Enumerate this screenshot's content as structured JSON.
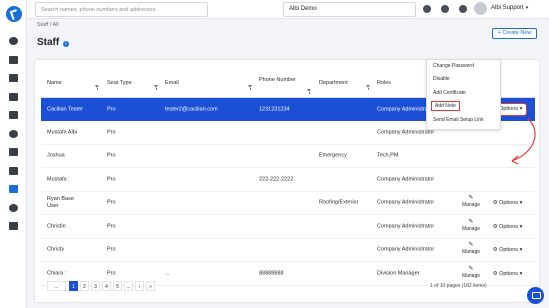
{
  "header": {
    "search_placeholder": "Search names, phone numbers and addresses",
    "company": "Albi Demo",
    "user": "Albi Support"
  },
  "breadcrumb": "Staff / All",
  "page_title": "Staff",
  "create_button": "+ Create New",
  "table": {
    "columns": [
      "Name",
      "Seat Type",
      "Email",
      "Phone Number",
      "Department",
      "Roles"
    ],
    "rows": [
      {
        "name": "Cacilian Tester",
        "seat": "Pro",
        "email": "tester2@cacilian.com",
        "phone": "1231231234",
        "department": "",
        "role": "Company Administrator"
      },
      {
        "name": "Mustafa Albi",
        "seat": "Pro",
        "email": "",
        "phone": "",
        "department": "",
        "role": "Company Administrator"
      },
      {
        "name": "Joshua",
        "seat": "Pro",
        "email": "",
        "phone": "",
        "department": "Emergency",
        "role": "Tech,PM"
      },
      {
        "name": "Mustafa :",
        "seat": "Pro",
        "email": "",
        "phone": "222-222-2222",
        "department": "",
        "role": "Company Administrator"
      },
      {
        "name": "Ryan Base User",
        "seat": "Pro",
        "email": "",
        "phone": "",
        "department": "Roofing/Exterior",
        "role": "Company Administrator"
      },
      {
        "name": "Christin",
        "seat": "Pro",
        "email": "",
        "phone": "",
        "department": "",
        "role": "Company Administrator"
      },
      {
        "name": "Christy",
        "seat": "Pro",
        "email": "",
        "phone": "",
        "department": "",
        "role": "Company Administrator"
      },
      {
        "name": "Chiara :",
        "seat": "Pro",
        "email": "...",
        "phone": "88888888",
        "department": "",
        "role": "Division Manager"
      }
    ],
    "manage_label": "Manage",
    "options_label": "Options"
  },
  "dropdown": {
    "items": [
      "Change Password",
      "Disable",
      "Add Certificate",
      "Add Note",
      "Send Email Setup Link"
    ],
    "highlighted": "Add Note"
  },
  "pagination": {
    "prev": "...",
    "pages": [
      "1",
      "2",
      "3",
      "4",
      "5"
    ],
    "ellipsis": "...",
    "next": "›",
    "last": "»",
    "active": "1",
    "info": "1 of 10 pages (182 items)"
  },
  "colors": {
    "accent": "#1b4fd6",
    "highlight": "#e53935"
  }
}
